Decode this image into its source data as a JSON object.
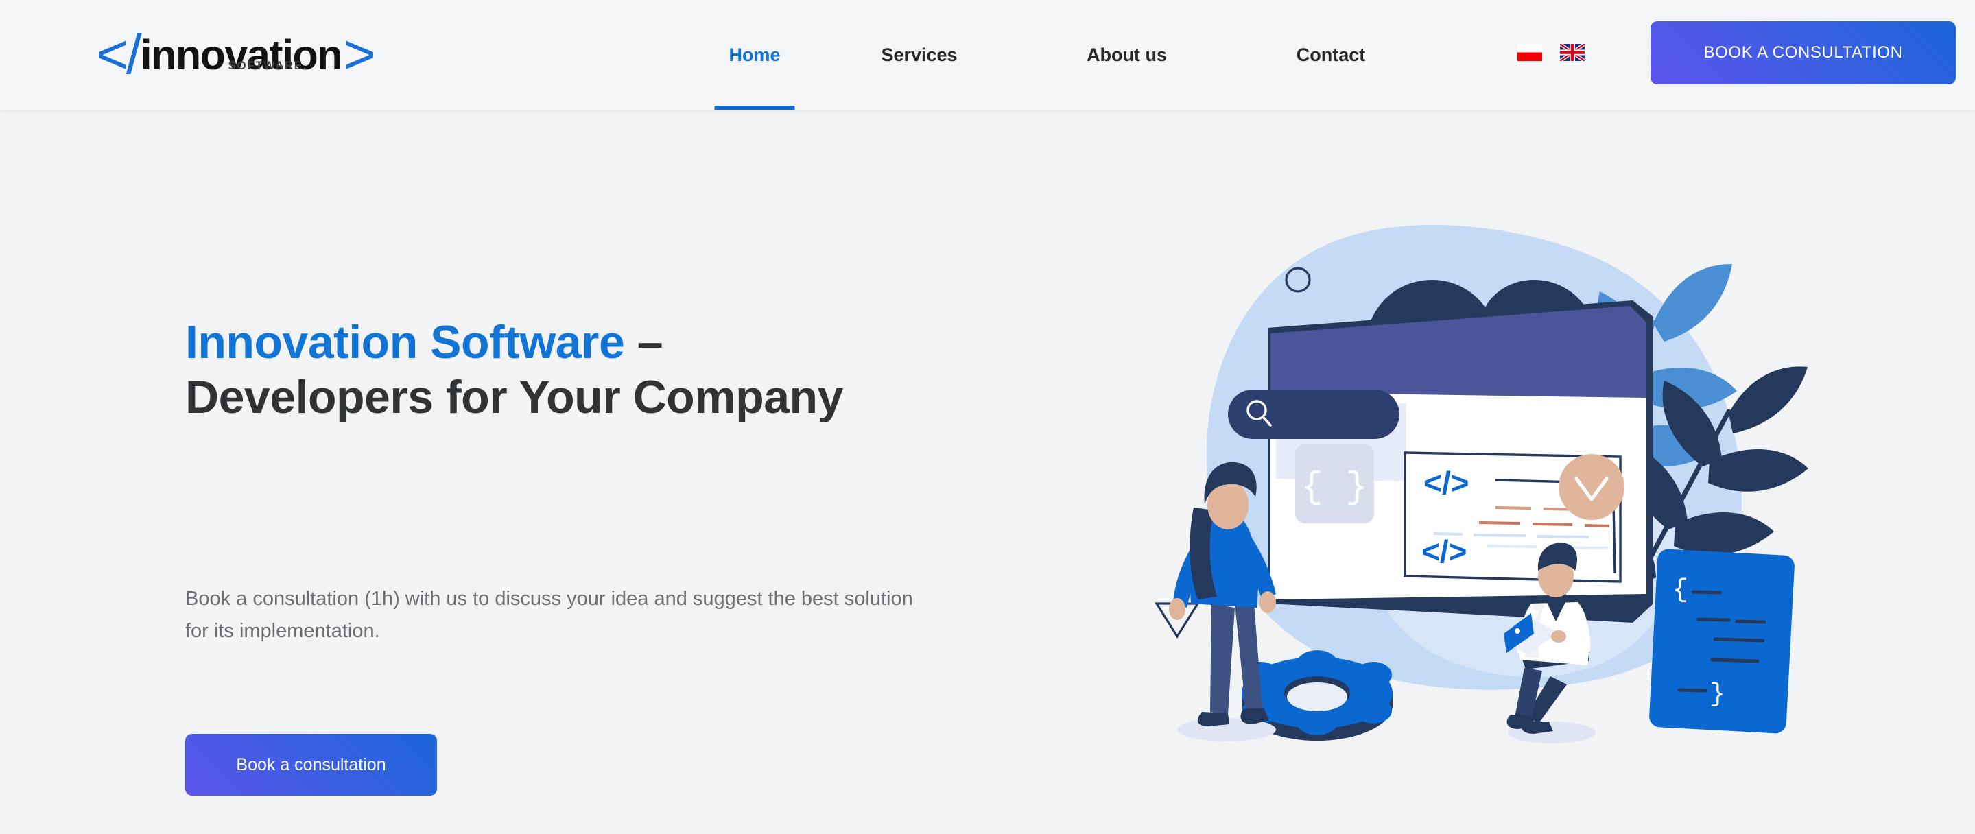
{
  "brand": {
    "logo_open": "</",
    "logo_word": "innovation",
    "logo_close": ">",
    "logo_sub": "SOFTWARE.",
    "accent_blue": "#1274d4",
    "logo_bracket_blue": "#1a6fd4"
  },
  "header": {
    "nav": [
      {
        "label": "Home",
        "active": true
      },
      {
        "label": "Services",
        "active": false
      },
      {
        "label": "About us",
        "active": false
      },
      {
        "label": "Contact",
        "active": false
      }
    ],
    "languages": [
      {
        "name": "polish-flag",
        "code": "PL"
      },
      {
        "name": "english-flag",
        "code": "EN"
      }
    ],
    "cta_label": "BOOK A CONSULTATION",
    "cta_gradient_from": "#5b54e8",
    "cta_gradient_to": "#1c66d8"
  },
  "hero": {
    "title_accent": "Innovation Software",
    "title_rest": " – Developers for Your Company",
    "subtitle": "Book a consultation (1h) with us to discuss your idea and suggest the best solution for its implementation.",
    "cta_label": "Book a consultation",
    "illustration": {
      "name": "developers-coding-illustration",
      "elements": [
        "blob-background",
        "cloud-download-icon",
        "browser-window",
        "search-bar",
        "curly-braces-tile",
        "code-tag-icons",
        "chevron-down-badge",
        "plant-leaves",
        "json-code-card",
        "gear-icon",
        "standing-woman",
        "sitting-man-with-laptop",
        "outline-circle",
        "outline-triangle"
      ],
      "colors": {
        "blob": "#c5daf5",
        "blob_light": "#dbe8fa",
        "navy": "#25395c",
        "indigo": "#4a5699",
        "blue": "#0b68d1",
        "leaf_light": "#4a8fd4",
        "skin": "#dfb59c",
        "white": "#ffffff"
      }
    }
  },
  "page": {
    "background": "#f2f3f4",
    "header_background": "#f4f5f6"
  }
}
